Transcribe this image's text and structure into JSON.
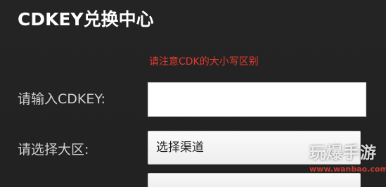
{
  "header": {
    "title": "CDKEY兑换中心"
  },
  "notice": {
    "text": "请注意CDK的大小写区别"
  },
  "form": {
    "cdkey_label": "请输入CDKEY:",
    "cdkey_value": "",
    "region_label": "请选择大区:",
    "channel_select_value": "选择渠道"
  },
  "watermark": {
    "text": "玩爆手游",
    "url": "www.wanbao.com"
  },
  "colors": {
    "background": "#232323",
    "notice": "#e23a2e",
    "input_background": "#ffffff"
  }
}
